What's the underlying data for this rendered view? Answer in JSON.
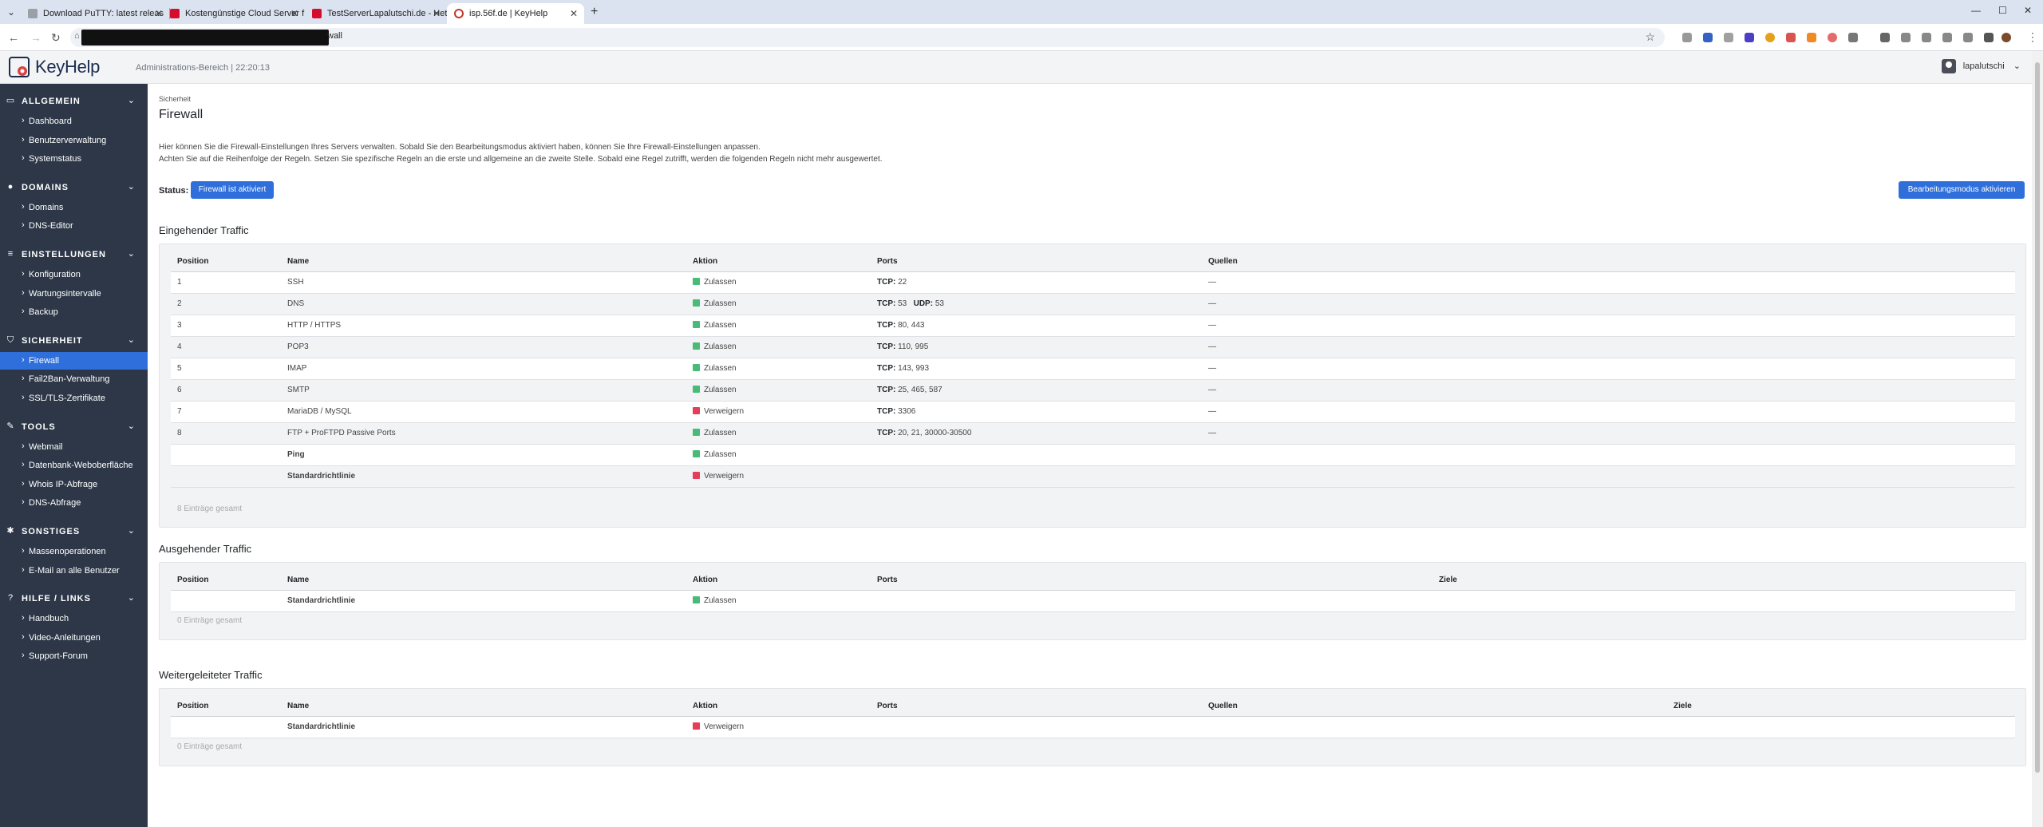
{
  "browser": {
    "tabs": [
      {
        "title": "Download PuTTY: latest releas",
        "favicon": "putty"
      },
      {
        "title": "Kostengünstige Cloud Server f",
        "favicon": "hetz"
      },
      {
        "title": "TestServerLapalutschi.de - Hetz",
        "favicon": "hetz"
      },
      {
        "title": "isp.56f.de | KeyHelp",
        "favicon": "kh"
      }
    ],
    "url_tail": "wall"
  },
  "app": {
    "logo": "KeyHelp",
    "admin_info": "Administrations-Bereich | 22:20:13",
    "username": "lapalutschi"
  },
  "sidebar": [
    {
      "header": "ALLGEMEIN",
      "icon": "monitor-icon",
      "items": [
        "Dashboard",
        "Benutzerverwaltung",
        "Systemstatus"
      ]
    },
    {
      "header": "DOMAINS",
      "icon": "globe-icon",
      "items": [
        "Domains",
        "DNS-Editor"
      ]
    },
    {
      "header": "EINSTELLUNGEN",
      "icon": "sliders-icon",
      "items": [
        "Konfiguration",
        "Wartungsintervalle",
        "Backup"
      ]
    },
    {
      "header": "SICHERHEIT",
      "icon": "shield-icon",
      "items": [
        "Firewall",
        "Fail2Ban-Verwaltung",
        "SSL/TLS-Zertifikate"
      ]
    },
    {
      "header": "TOOLS",
      "icon": "wrench-icon",
      "items": [
        "Webmail",
        "Datenbank-Weboberfläche",
        "Whois IP-Abfrage",
        "DNS-Abfrage"
      ]
    },
    {
      "header": "SONSTIGES",
      "icon": "gear-icon",
      "items": [
        "Massenoperationen",
        "E-Mail an alle Benutzer"
      ]
    },
    {
      "header": "HILFE / LINKS",
      "icon": "help-icon",
      "items": [
        "Handbuch",
        "Video-Anleitungen",
        "Support-Forum"
      ]
    }
  ],
  "page": {
    "breadcrumb": "Sicherheit",
    "title": "Firewall",
    "desc1": "Hier können Sie die Firewall-Einstellungen Ihres Servers verwalten. Sobald Sie den Bearbeitungsmodus aktiviert haben, können Sie Ihre Firewall-Einstellungen anpassen.",
    "desc2": "Achten Sie auf die Reihenfolge der Regeln. Setzen Sie spezifische Regeln an die erste und allgemeine an die zweite Stelle. Sobald eine Regel zutrifft, werden die folgenden Regeln nicht mehr ausgewertet.",
    "status_label": "Status:",
    "status_button": "Firewall ist aktiviert",
    "edit_button": "Bearbeitungsmodus aktivieren"
  },
  "incoming": {
    "title": "Eingehender Traffic",
    "columns": [
      "Position",
      "Name",
      "Aktion",
      "Ports",
      "Quellen"
    ],
    "rows": [
      {
        "pos": "1",
        "name": "SSH",
        "action": "Zulassen",
        "ok": true,
        "tcp": "22",
        "udp": "",
        "src": "—"
      },
      {
        "pos": "2",
        "name": "DNS",
        "action": "Zulassen",
        "ok": true,
        "tcp": "53",
        "udp": "53",
        "src": "—"
      },
      {
        "pos": "3",
        "name": "HTTP / HTTPS",
        "action": "Zulassen",
        "ok": true,
        "tcp": "80, 443",
        "udp": "",
        "src": "—"
      },
      {
        "pos": "4",
        "name": "POP3",
        "action": "Zulassen",
        "ok": true,
        "tcp": "110, 995",
        "udp": "",
        "src": "—"
      },
      {
        "pos": "5",
        "name": "IMAP",
        "action": "Zulassen",
        "ok": true,
        "tcp": "143, 993",
        "udp": "",
        "src": "—"
      },
      {
        "pos": "6",
        "name": "SMTP",
        "action": "Zulassen",
        "ok": true,
        "tcp": "25, 465, 587",
        "udp": "",
        "src": "—"
      },
      {
        "pos": "7",
        "name": "MariaDB / MySQL",
        "action": "Verweigern",
        "ok": false,
        "tcp": "3306",
        "udp": "",
        "src": "—"
      },
      {
        "pos": "8",
        "name": "FTP + ProFTPD Passive Ports",
        "action": "Zulassen",
        "ok": true,
        "tcp": "20, 21, 30000-30500",
        "udp": "",
        "src": "—"
      },
      {
        "pos": "",
        "name": "Ping",
        "action": "Zulassen",
        "ok": true,
        "tcp": "",
        "udp": "",
        "src": "",
        "bold": true
      },
      {
        "pos": "",
        "name": "Standardrichtlinie",
        "action": "Verweigern",
        "ok": false,
        "tcp": "",
        "udp": "",
        "src": "",
        "bold": true
      }
    ],
    "count": "8 Einträge gesamt"
  },
  "outgoing": {
    "title": "Ausgehender Traffic",
    "columns": [
      "Position",
      "Name",
      "Aktion",
      "Ports",
      "Ziele"
    ],
    "rows": [
      {
        "pos": "",
        "name": "Standardrichtlinie",
        "action": "Zulassen",
        "ok": true
      }
    ],
    "count": "0 Einträge gesamt"
  },
  "forwarded": {
    "title": "Weitergeleiteter Traffic",
    "columns": [
      "Position",
      "Name",
      "Aktion",
      "Ports",
      "Quellen",
      "Ziele"
    ],
    "rows": [
      {
        "pos": "",
        "name": "Standardrichtlinie",
        "action": "Verweigern",
        "ok": false
      }
    ],
    "count": "0 Einträge gesamt"
  },
  "labels": {
    "tcp": "TCP:",
    "udp": "UDP:"
  },
  "colors": {
    "sidebar_bg": "#2d3748",
    "accent": "#2f6fdb",
    "allow": "#48bb78",
    "deny": "#e53e5a"
  }
}
